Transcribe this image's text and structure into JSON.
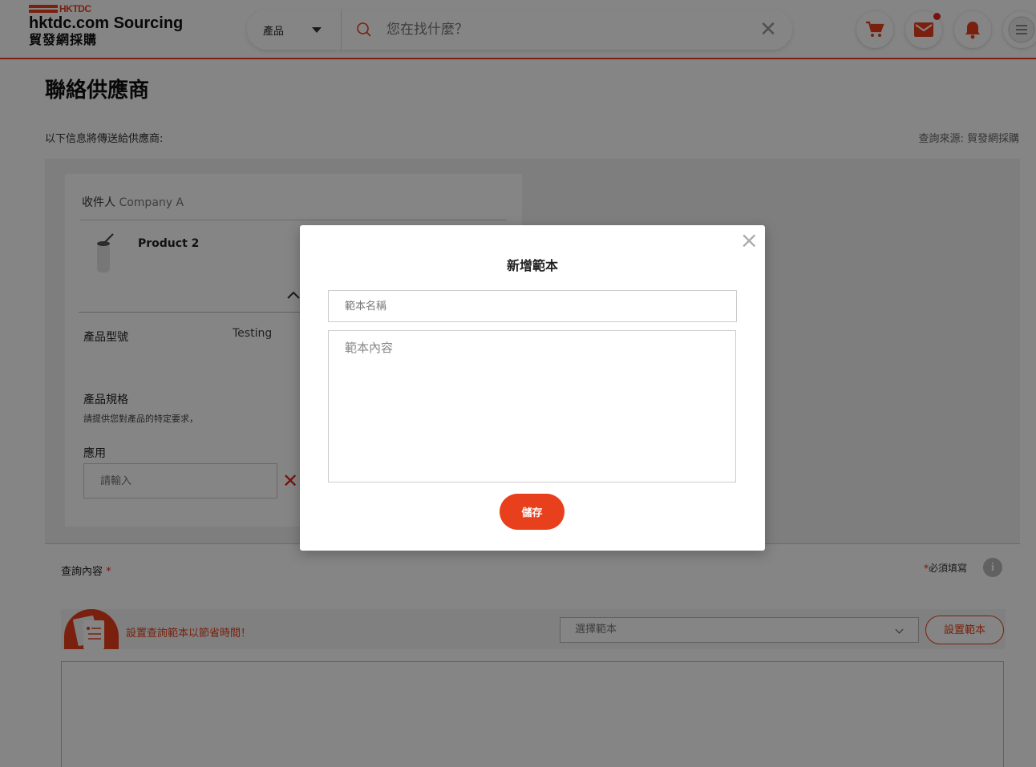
{
  "header": {
    "logo_mark": "HKTDC",
    "logo_name": "hktdc.com Sourcing",
    "logo_cn": "貿發網採購",
    "search": {
      "category": "產品",
      "placeholder": "您在找什麼？",
      "clear": "✕"
    },
    "icons": [
      "cart-icon",
      "mail-icon",
      "bell-icon",
      "menu-icon"
    ],
    "mail_has_notification": true
  },
  "page": {
    "title": "聯絡供應商",
    "info_left": "以下信息將傳送給供應商:",
    "info_right": "查詢來源: 貿發網採購",
    "recipient_label": "收件人",
    "recipient_company": "Company A",
    "product": {
      "name": "Product 2"
    },
    "specs": [
      {
        "label": "產品型號",
        "value": "Testing"
      }
    ],
    "spec_section": {
      "label": "產品規格",
      "hint": "請提供您對產品的特定要求，"
    },
    "application": {
      "label": "應用",
      "placeholder": "請輸入"
    },
    "enquiry": {
      "label": "查詢內容",
      "required_star": "*",
      "required_note": "必須填寫",
      "info": "i",
      "template_hint": "設置查詢範本以節省時間！",
      "template_select_placeholder": "選擇範本",
      "template_button": "設置範本"
    }
  },
  "modal": {
    "title": "新增範本",
    "name_placeholder": "範本名稱",
    "content_placeholder": "範本內容",
    "save": "儲存",
    "close": "×"
  },
  "colors": {
    "brand": "#e8401c",
    "overlay": "rgba(0,0,0,0.48)"
  }
}
